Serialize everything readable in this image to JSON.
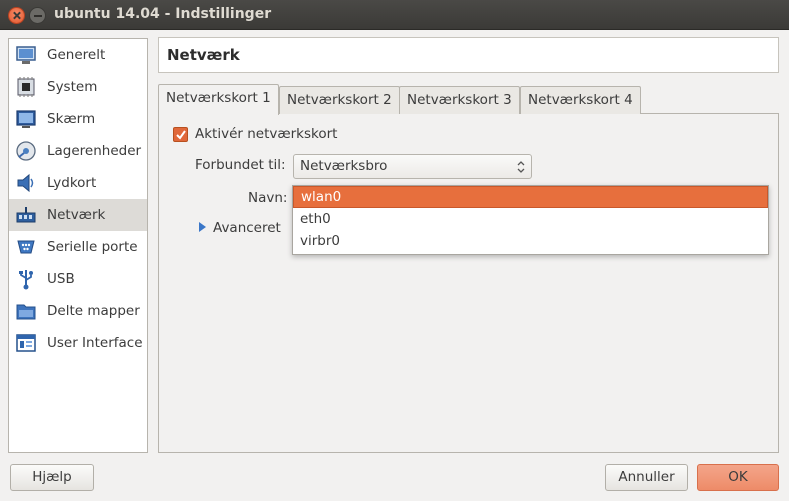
{
  "window": {
    "title": "ubuntu 14.04 - Indstillinger"
  },
  "sidebar": {
    "items": [
      {
        "label": "Generelt",
        "icon": "monitor-icon"
      },
      {
        "label": "System",
        "icon": "chip-icon"
      },
      {
        "label": "Skærm",
        "icon": "display-icon"
      },
      {
        "label": "Lagerenheder",
        "icon": "disk-icon"
      },
      {
        "label": "Lydkort",
        "icon": "speaker-icon"
      },
      {
        "label": "Netværk",
        "icon": "network-icon",
        "selected": true
      },
      {
        "label": "Serielle porte",
        "icon": "serial-port-icon"
      },
      {
        "label": "USB",
        "icon": "usb-icon"
      },
      {
        "label": "Delte mapper",
        "icon": "folder-icon"
      },
      {
        "label": "User Interface",
        "icon": "ui-window-icon"
      }
    ]
  },
  "page": {
    "title": "Netværk"
  },
  "tabs": [
    {
      "label": "Netværkskort 1",
      "active": true
    },
    {
      "label": "Netværkskort 2"
    },
    {
      "label": "Netværkskort 3"
    },
    {
      "label": "Netværkskort 4"
    }
  ],
  "form": {
    "enable_label": "Aktivér netværkskort",
    "enable_checked": true,
    "attached_label": "Forbundet til:",
    "attached_value": "Netværksbro",
    "name_label": "Navn:",
    "advanced_label": "Avanceret"
  },
  "name_dropdown": {
    "options": [
      "wlan0",
      "eth0",
      "virbr0"
    ],
    "selected": "wlan0"
  },
  "buttons": {
    "help": "Hjælp",
    "cancel": "Annuller",
    "ok": "OK"
  },
  "colors": {
    "accent": "#e76f3d",
    "titlebar": "#3c3b37"
  }
}
